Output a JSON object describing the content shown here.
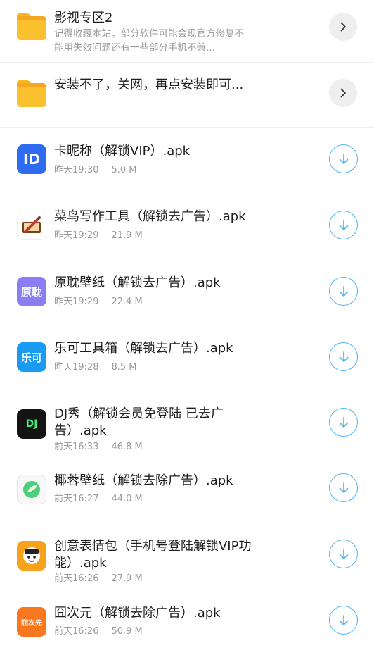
{
  "folders": [
    {
      "title": "影视专区2",
      "desc_line1": "记得收藏本站，部分软件可能会现官方修复不",
      "desc_line2": "能用失效问题还有一些部分手机不兼...",
      "icon": "folder-icon"
    },
    {
      "title": "安装不了，关网，再点安装即可...",
      "icon": "folder-icon"
    }
  ],
  "files": [
    {
      "name_line1": "卡昵称（解锁VIP）.apk",
      "time": "昨天19:30",
      "size": "5.0 M",
      "icon_text": "ID"
    },
    {
      "name_line1": "菜鸟写作工具（解锁去广告）.apk",
      "time": "昨天19:29",
      "size": "21.9 M",
      "icon_text": ""
    },
    {
      "name_line1": "原耽壁纸（解锁去广告）.apk",
      "time": "昨天19:29",
      "size": "22.4 M",
      "icon_text": "原耽"
    },
    {
      "name_line1": "乐可工具箱（解锁去广告）.apk",
      "time": "昨天19:28",
      "size": "8.5 M",
      "icon_text": "乐可"
    },
    {
      "name_line1": "DJ秀（解锁会员免登陆 已去广",
      "name_line2": "告）.apk",
      "time": "前天16:33",
      "size": "46.8 M",
      "icon_text": "DJ"
    },
    {
      "name_line1": "椰蓉壁纸（解锁去除广告）.apk",
      "time": "前天16:27",
      "size": "44.0 M",
      "icon_text": ""
    },
    {
      "name_line1": "创意表情包（手机号登陆解锁VIP功",
      "name_line2": "能）.apk",
      "time": "前天16:26",
      "size": "27.9 M",
      "icon_text": ""
    },
    {
      "name_line1": "囧次元（解锁去除广告）.apk",
      "time": "前天16:26",
      "size": "50.9 M",
      "icon_text": "囧次元"
    }
  ],
  "colors": {
    "accent": "#52b7f0",
    "folder": "#fbc02d",
    "meta_text": "#9a9a9a"
  }
}
